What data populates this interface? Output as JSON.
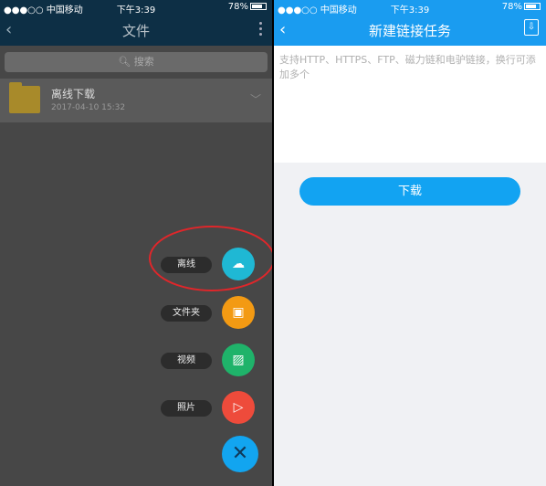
{
  "left": {
    "status": {
      "carrier": "●●●○○ 中国移动",
      "time": "下午3:39",
      "battery": "78%"
    },
    "nav": {
      "title": "文件",
      "back_icon": "chevron-left-icon",
      "more_icon": "more-vert-icon"
    },
    "search": {
      "placeholder": "搜索"
    },
    "file": {
      "name": "离线下载",
      "date": "2017-04-10 15:32"
    },
    "fab_menu": [
      {
        "label": "离线",
        "color": "#1fb8d4",
        "icon": "cloud-download-icon"
      },
      {
        "label": "文件夹",
        "color": "#f39a13",
        "icon": "folder-add-icon"
      },
      {
        "label": "视频",
        "color": "#1fb36a",
        "icon": "image-icon"
      },
      {
        "label": "照片",
        "color": "#ee4b3b",
        "icon": "play-icon"
      }
    ],
    "close_symbol": "✕"
  },
  "right": {
    "status": {
      "carrier": "●●●○○ 中国移动",
      "time": "下午3:39",
      "battery": "78%"
    },
    "nav": {
      "title": "新建链接任务"
    },
    "textarea_placeholder": "支持HTTP、HTTPS、FTP、磁力链和电驴链接，换行可添加多个",
    "download_label": "下载"
  }
}
